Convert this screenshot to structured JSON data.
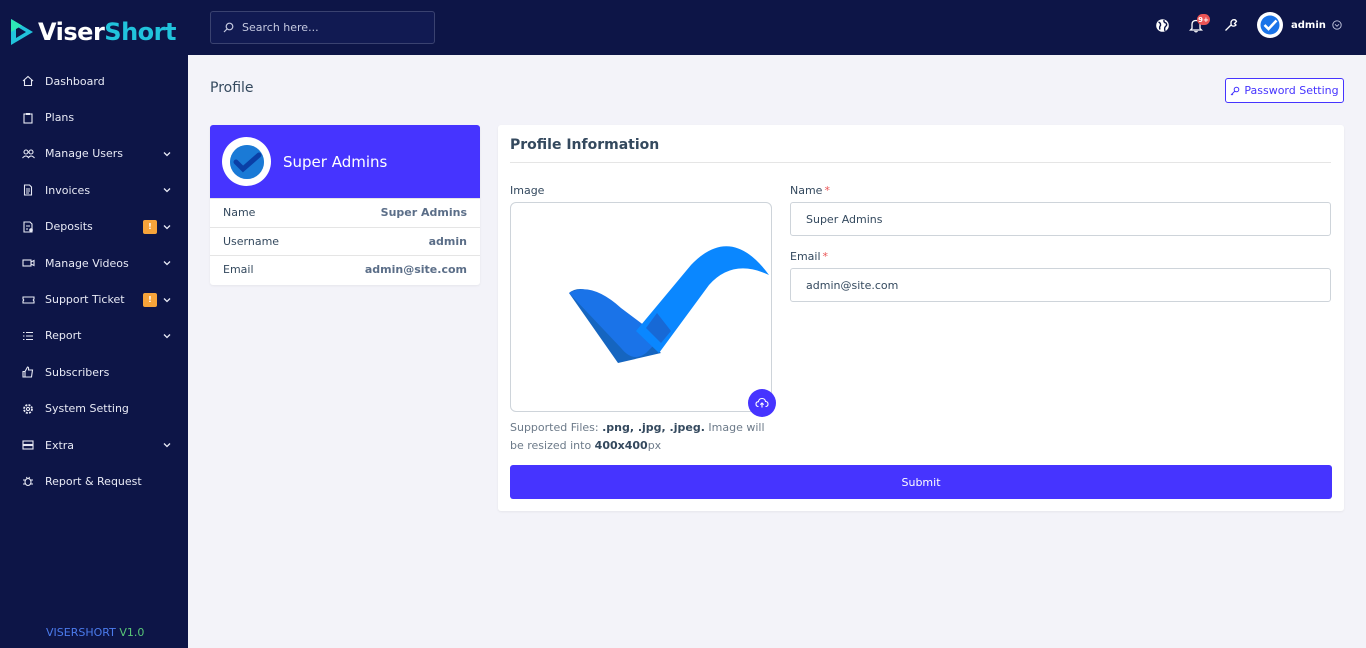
{
  "brand": {
    "name_part1": "Viser",
    "name_part2": "Short",
    "version_name": "VISERSHORT",
    "version_number": "V1.0"
  },
  "colors": {
    "sidebar_bg": "#0d1547",
    "primary": "#4634ff",
    "warning_badge": "#f7a43a",
    "danger": "#ea5455"
  },
  "sidebar": {
    "items": [
      {
        "label": "Dashboard",
        "icon": "home-icon",
        "dropdown": false
      },
      {
        "label": "Plans",
        "icon": "clipboard-icon",
        "dropdown": false
      },
      {
        "label": "Manage Users",
        "icon": "users-icon",
        "dropdown": true
      },
      {
        "label": "Invoices",
        "icon": "file-icon",
        "dropdown": true
      },
      {
        "label": "Deposits",
        "icon": "deposit-icon",
        "dropdown": true,
        "badge": "!"
      },
      {
        "label": "Manage Videos",
        "icon": "video-icon",
        "dropdown": true
      },
      {
        "label": "Support Ticket",
        "icon": "ticket-icon",
        "dropdown": true,
        "badge": "!"
      },
      {
        "label": "Report",
        "icon": "list-icon",
        "dropdown": true
      },
      {
        "label": "Subscribers",
        "icon": "thumbs-up-icon",
        "dropdown": false
      },
      {
        "label": "System Setting",
        "icon": "gear-icon",
        "dropdown": false
      },
      {
        "label": "Extra",
        "icon": "server-icon",
        "dropdown": true
      },
      {
        "label": "Report & Request",
        "icon": "bug-icon",
        "dropdown": false
      }
    ]
  },
  "topbar": {
    "search_placeholder": "Search here...",
    "notification_count": "9+",
    "username": "admin"
  },
  "page": {
    "title": "Profile",
    "password_button": "Password Setting"
  },
  "profile_card": {
    "name": "Super Admins",
    "rows": [
      {
        "key": "Name",
        "value": "Super Admins"
      },
      {
        "key": "Username",
        "value": "admin"
      },
      {
        "key": "Email",
        "value": "admin@site.com"
      }
    ]
  },
  "form": {
    "title": "Profile Information",
    "image_label": "Image",
    "help_prefix": "Supported Files: ",
    "help_types": ".png, .jpg, .jpeg.",
    "help_mid": " Image will be resized into ",
    "help_size": "400x400",
    "help_suffix": "px",
    "name_label": "Name",
    "name_value": "Super Admins",
    "email_label": "Email",
    "email_value": "admin@site.com",
    "required_mark": "*",
    "submit_label": "Submit"
  }
}
